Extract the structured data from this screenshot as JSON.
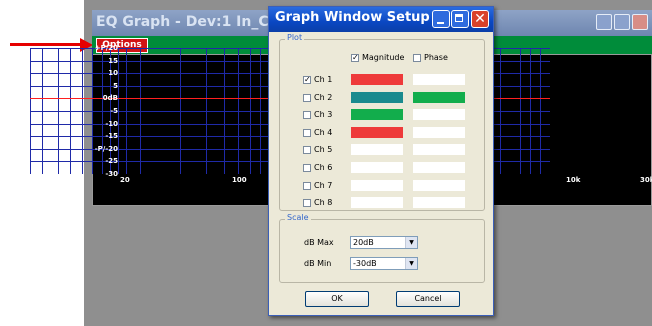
{
  "eq_window": {
    "title": "EQ Graph - Dev:1 In_Ch:1",
    "options_label": "Options",
    "y_labels": [
      "+P/20",
      "15",
      "10",
      "5",
      "0dB",
      "-5",
      "-10",
      "-15",
      "-P/-20",
      "-25",
      "-30"
    ],
    "x_labels": [
      "20",
      "100",
      "10k",
      "30k"
    ],
    "graph_colors": {
      "grid": "#1f2aa8",
      "zero_line": "#ff2020",
      "background": "#000000"
    }
  },
  "dialog": {
    "title": "Graph Window Setup",
    "close_glyph": "✕",
    "plot_group_label": "Plot",
    "magnitude_label": "Magnitude",
    "magnitude_checked": true,
    "phase_label": "Phase",
    "phase_checked": false,
    "check_glyph": "✓",
    "channels": [
      {
        "label": "Ch 1",
        "checked": true,
        "magnitude_color": "#ee3a3a",
        "phase_color": "#ffffff"
      },
      {
        "label": "Ch 2",
        "checked": false,
        "magnitude_color": "#1a8a8e",
        "phase_color": "#12ad4c"
      },
      {
        "label": "Ch 3",
        "checked": false,
        "magnitude_color": "#12ad4c",
        "phase_color": "#ffffff"
      },
      {
        "label": "Ch 4",
        "checked": false,
        "magnitude_color": "#ee3a3a",
        "phase_color": "#ffffff"
      },
      {
        "label": "Ch 5",
        "checked": false,
        "magnitude_color": "#ffffff",
        "phase_color": "#ffffff"
      },
      {
        "label": "Ch 6",
        "checked": false,
        "magnitude_color": "#ffffff",
        "phase_color": "#ffffff"
      },
      {
        "label": "Ch 7",
        "checked": false,
        "magnitude_color": "#ffffff",
        "phase_color": "#ffffff"
      },
      {
        "label": "Ch 8",
        "checked": false,
        "magnitude_color": "#ffffff",
        "phase_color": "#ffffff"
      }
    ],
    "scale_group_label": "Scale",
    "db_max_label": "dB Max",
    "db_max_value": "20dB",
    "db_min_label": "dB Min",
    "db_min_value": "-30dB",
    "ok_label": "OK",
    "cancel_label": "Cancel"
  },
  "colors": {
    "arrow": "#e60000",
    "dialog_title": "#0a47c2"
  }
}
